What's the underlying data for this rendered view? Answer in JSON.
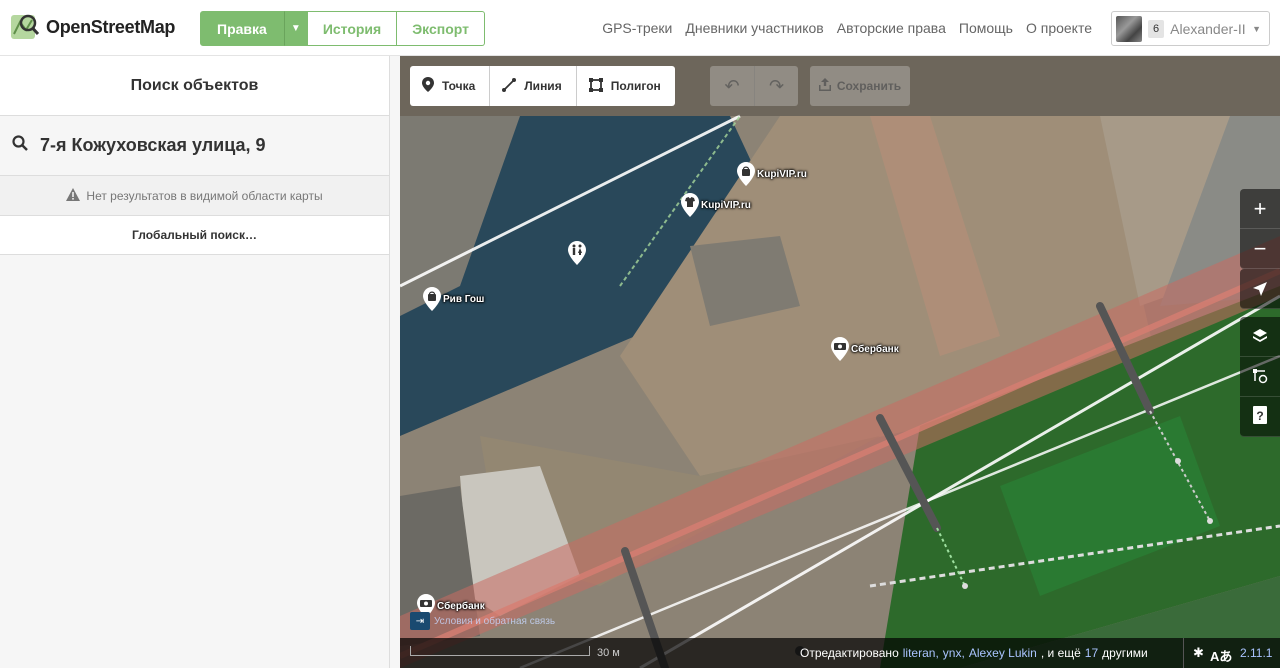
{
  "header": {
    "logo_text": "OpenStreetMap",
    "edit_label": "Правка",
    "history_label": "История",
    "export_label": "Экспорт",
    "nav": [
      "GPS-треки",
      "Дневники участников",
      "Авторские права",
      "Помощь",
      "О проекте"
    ],
    "user": {
      "badge": "6",
      "name": "Alexander-II"
    }
  },
  "sidebar": {
    "title": "Поиск объектов",
    "search_value": "7-я Кожуховская улица, 9",
    "no_results": "Нет результатов в видимой области карты",
    "global_search": "Глобальный поиск…"
  },
  "map": {
    "tools": {
      "point": "Точка",
      "line": "Линия",
      "polygon": "Полигон"
    },
    "save_label": "Сохранить",
    "pois": [
      {
        "label": "KupiVIP.ru",
        "icon": "shopping-bag-icon"
      },
      {
        "label": "KupiVIP.ru",
        "icon": "shirt-icon"
      },
      {
        "label": "",
        "icon": "toilets-icon"
      },
      {
        "label": "Рив Гош",
        "icon": "shopping-bag-icon"
      },
      {
        "label": "Сбербанк",
        "icon": "bank-icon"
      },
      {
        "label": "Сбербанк",
        "icon": "bank-icon"
      }
    ],
    "terms_text": "Условия и обратная связь",
    "scale_label": "30 м",
    "attribution": {
      "prefix": "Отредактировано",
      "users": [
        "literan",
        "ynx",
        "Alexey Lukin"
      ],
      "and_more": ", и ещё",
      "count": "17",
      "suffix": "другими"
    },
    "version": "2.11.1"
  }
}
